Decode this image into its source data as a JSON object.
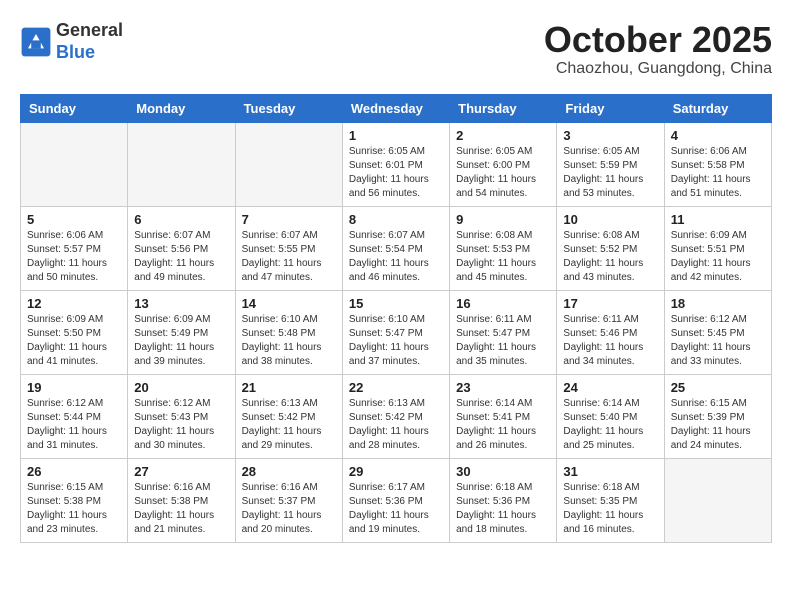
{
  "logo": {
    "general": "General",
    "blue": "Blue"
  },
  "title": "October 2025",
  "location": "Chaozhou, Guangdong, China",
  "weekdays": [
    "Sunday",
    "Monday",
    "Tuesday",
    "Wednesday",
    "Thursday",
    "Friday",
    "Saturday"
  ],
  "weeks": [
    [
      {
        "day": "",
        "info": ""
      },
      {
        "day": "",
        "info": ""
      },
      {
        "day": "",
        "info": ""
      },
      {
        "day": "1",
        "info": "Sunrise: 6:05 AM\nSunset: 6:01 PM\nDaylight: 11 hours\nand 56 minutes."
      },
      {
        "day": "2",
        "info": "Sunrise: 6:05 AM\nSunset: 6:00 PM\nDaylight: 11 hours\nand 54 minutes."
      },
      {
        "day": "3",
        "info": "Sunrise: 6:05 AM\nSunset: 5:59 PM\nDaylight: 11 hours\nand 53 minutes."
      },
      {
        "day": "4",
        "info": "Sunrise: 6:06 AM\nSunset: 5:58 PM\nDaylight: 11 hours\nand 51 minutes."
      }
    ],
    [
      {
        "day": "5",
        "info": "Sunrise: 6:06 AM\nSunset: 5:57 PM\nDaylight: 11 hours\nand 50 minutes."
      },
      {
        "day": "6",
        "info": "Sunrise: 6:07 AM\nSunset: 5:56 PM\nDaylight: 11 hours\nand 49 minutes."
      },
      {
        "day": "7",
        "info": "Sunrise: 6:07 AM\nSunset: 5:55 PM\nDaylight: 11 hours\nand 47 minutes."
      },
      {
        "day": "8",
        "info": "Sunrise: 6:07 AM\nSunset: 5:54 PM\nDaylight: 11 hours\nand 46 minutes."
      },
      {
        "day": "9",
        "info": "Sunrise: 6:08 AM\nSunset: 5:53 PM\nDaylight: 11 hours\nand 45 minutes."
      },
      {
        "day": "10",
        "info": "Sunrise: 6:08 AM\nSunset: 5:52 PM\nDaylight: 11 hours\nand 43 minutes."
      },
      {
        "day": "11",
        "info": "Sunrise: 6:09 AM\nSunset: 5:51 PM\nDaylight: 11 hours\nand 42 minutes."
      }
    ],
    [
      {
        "day": "12",
        "info": "Sunrise: 6:09 AM\nSunset: 5:50 PM\nDaylight: 11 hours\nand 41 minutes."
      },
      {
        "day": "13",
        "info": "Sunrise: 6:09 AM\nSunset: 5:49 PM\nDaylight: 11 hours\nand 39 minutes."
      },
      {
        "day": "14",
        "info": "Sunrise: 6:10 AM\nSunset: 5:48 PM\nDaylight: 11 hours\nand 38 minutes."
      },
      {
        "day": "15",
        "info": "Sunrise: 6:10 AM\nSunset: 5:47 PM\nDaylight: 11 hours\nand 37 minutes."
      },
      {
        "day": "16",
        "info": "Sunrise: 6:11 AM\nSunset: 5:47 PM\nDaylight: 11 hours\nand 35 minutes."
      },
      {
        "day": "17",
        "info": "Sunrise: 6:11 AM\nSunset: 5:46 PM\nDaylight: 11 hours\nand 34 minutes."
      },
      {
        "day": "18",
        "info": "Sunrise: 6:12 AM\nSunset: 5:45 PM\nDaylight: 11 hours\nand 33 minutes."
      }
    ],
    [
      {
        "day": "19",
        "info": "Sunrise: 6:12 AM\nSunset: 5:44 PM\nDaylight: 11 hours\nand 31 minutes."
      },
      {
        "day": "20",
        "info": "Sunrise: 6:12 AM\nSunset: 5:43 PM\nDaylight: 11 hours\nand 30 minutes."
      },
      {
        "day": "21",
        "info": "Sunrise: 6:13 AM\nSunset: 5:42 PM\nDaylight: 11 hours\nand 29 minutes."
      },
      {
        "day": "22",
        "info": "Sunrise: 6:13 AM\nSunset: 5:42 PM\nDaylight: 11 hours\nand 28 minutes."
      },
      {
        "day": "23",
        "info": "Sunrise: 6:14 AM\nSunset: 5:41 PM\nDaylight: 11 hours\nand 26 minutes."
      },
      {
        "day": "24",
        "info": "Sunrise: 6:14 AM\nSunset: 5:40 PM\nDaylight: 11 hours\nand 25 minutes."
      },
      {
        "day": "25",
        "info": "Sunrise: 6:15 AM\nSunset: 5:39 PM\nDaylight: 11 hours\nand 24 minutes."
      }
    ],
    [
      {
        "day": "26",
        "info": "Sunrise: 6:15 AM\nSunset: 5:38 PM\nDaylight: 11 hours\nand 23 minutes."
      },
      {
        "day": "27",
        "info": "Sunrise: 6:16 AM\nSunset: 5:38 PM\nDaylight: 11 hours\nand 21 minutes."
      },
      {
        "day": "28",
        "info": "Sunrise: 6:16 AM\nSunset: 5:37 PM\nDaylight: 11 hours\nand 20 minutes."
      },
      {
        "day": "29",
        "info": "Sunrise: 6:17 AM\nSunset: 5:36 PM\nDaylight: 11 hours\nand 19 minutes."
      },
      {
        "day": "30",
        "info": "Sunrise: 6:18 AM\nSunset: 5:36 PM\nDaylight: 11 hours\nand 18 minutes."
      },
      {
        "day": "31",
        "info": "Sunrise: 6:18 AM\nSunset: 5:35 PM\nDaylight: 11 hours\nand 16 minutes."
      },
      {
        "day": "",
        "info": ""
      }
    ]
  ]
}
